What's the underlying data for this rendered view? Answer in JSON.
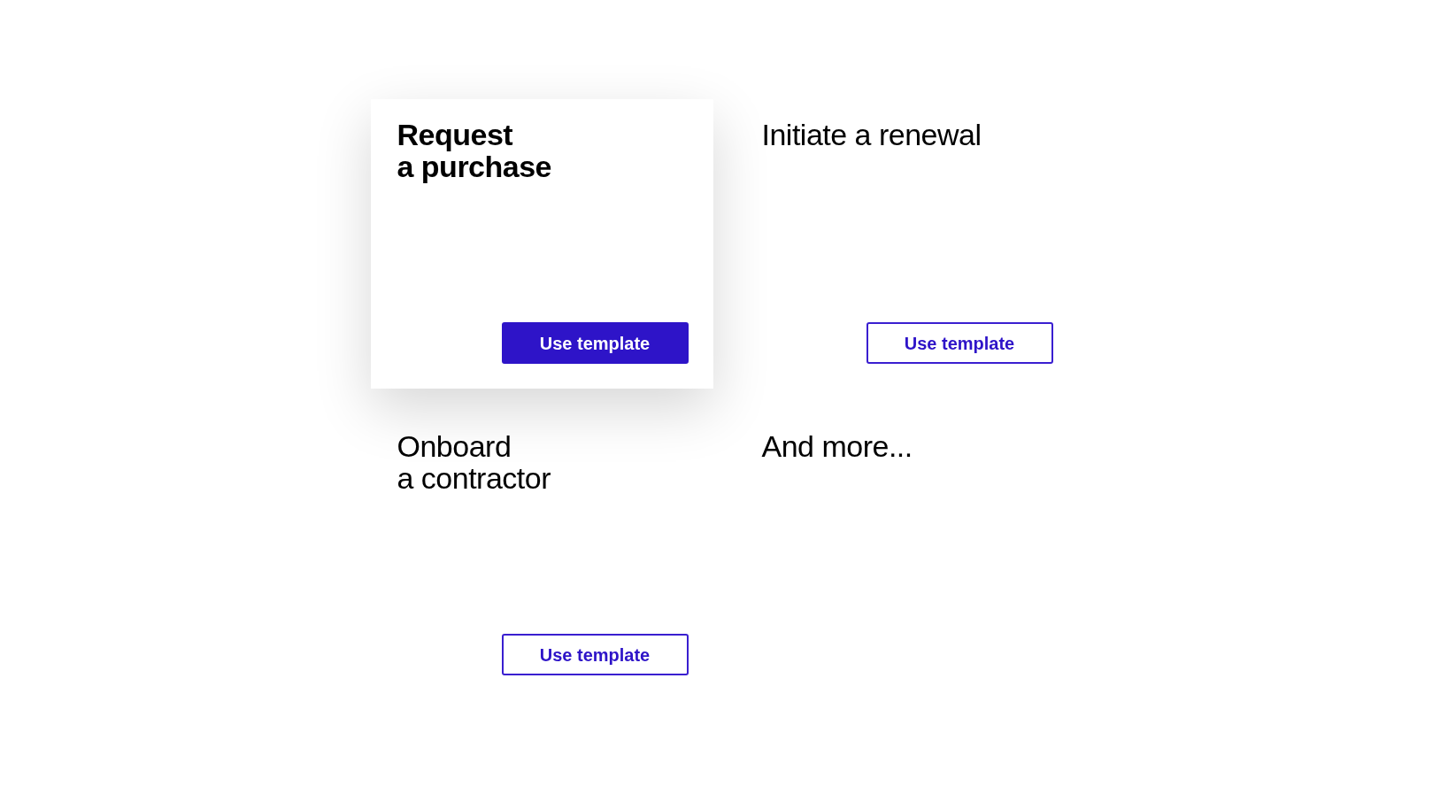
{
  "templates": [
    {
      "title": "Request\na purchase",
      "selected": true,
      "button": {
        "label": "Use template"
      }
    },
    {
      "title": "Initiate a renewal",
      "selected": false,
      "button": {
        "label": "Use template"
      }
    },
    {
      "title": "Onboard\na contractor",
      "selected": false,
      "button": {
        "label": "Use template"
      }
    },
    {
      "title": "And more...",
      "selected": false
    }
  ]
}
